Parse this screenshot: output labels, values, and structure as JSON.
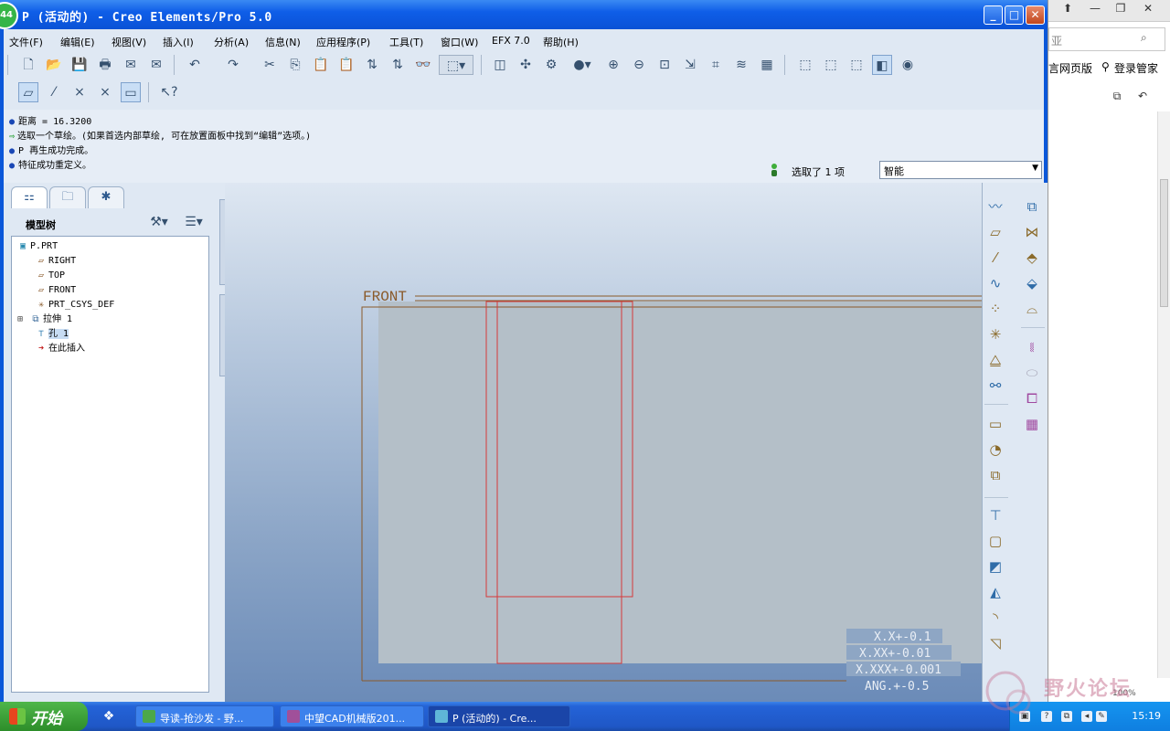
{
  "window": {
    "badge": "44",
    "title": "P (活动的) - Creo Elements/Pro 5.0",
    "minimize": "_",
    "maximize": "□",
    "close": "✕"
  },
  "menu": [
    "文件(F)",
    "编辑(E)",
    "视图(V)",
    "插入(I)",
    "分析(A)",
    "信息(N)",
    "应用程序(P)",
    "工具(T)",
    "窗口(W)",
    "EFX 7.0",
    "帮助(H)"
  ],
  "messages": [
    {
      "bullet": "●",
      "text": "距离 = 16.3200"
    },
    {
      "bullet": "⇨",
      "text": "选取一个草绘。(如果首选内部草绘, 可在放置面板中找到“编辑”选项。)"
    },
    {
      "bullet": "●",
      "text": "P 再生成功完成。"
    },
    {
      "bullet": "●",
      "text": "特征成功重定义。"
    }
  ],
  "selection": {
    "text": "选取了 1 项",
    "filter_value": "智能"
  },
  "navigator": {
    "header": "模型树",
    "tree": [
      {
        "icon": "part-icon",
        "label": "P.PRT",
        "selected": false
      },
      {
        "icon": "datum-plane-icon",
        "label": "RIGHT",
        "selected": false
      },
      {
        "icon": "datum-plane-icon",
        "label": "TOP",
        "selected": false
      },
      {
        "icon": "datum-plane-icon",
        "label": "FRONT",
        "selected": false
      },
      {
        "icon": "csys-icon",
        "label": "PRT_CSYS_DEF",
        "selected": false
      },
      {
        "icon": "extrude-icon",
        "label": "拉伸 1",
        "selected": false
      },
      {
        "icon": "hole-icon",
        "label": "孔 1",
        "selected": true
      },
      {
        "icon": "insert-here-icon",
        "label": "在此插入",
        "selected": false
      }
    ]
  },
  "graphics": {
    "plane_label": "FRONT",
    "tolerances": [
      "X.X+-0.1",
      "X.XX+-0.01",
      "X.XXX+-0.001",
      "ANG.+-0.5"
    ]
  },
  "browser": {
    "search_placeholder": "亚",
    "links": [
      "言网页版",
      "登录管家"
    ]
  },
  "taskbar": {
    "start": "开始",
    "tasks": [
      {
        "label": "导读-抢沙发 - 野...",
        "active": false
      },
      {
        "label": "中望CAD机械版201...",
        "active": false
      },
      {
        "label": "P (活动的) - Cre...",
        "active": true
      }
    ],
    "clock": "15:19",
    "zoom": "100%"
  },
  "watermark": "野火论坛",
  "colors": {
    "title_blue": "#0a52d6",
    "sketch_red": "#d63a3a",
    "plane_brown": "#8a5a2a",
    "part_gray": "#b4bfc8"
  }
}
